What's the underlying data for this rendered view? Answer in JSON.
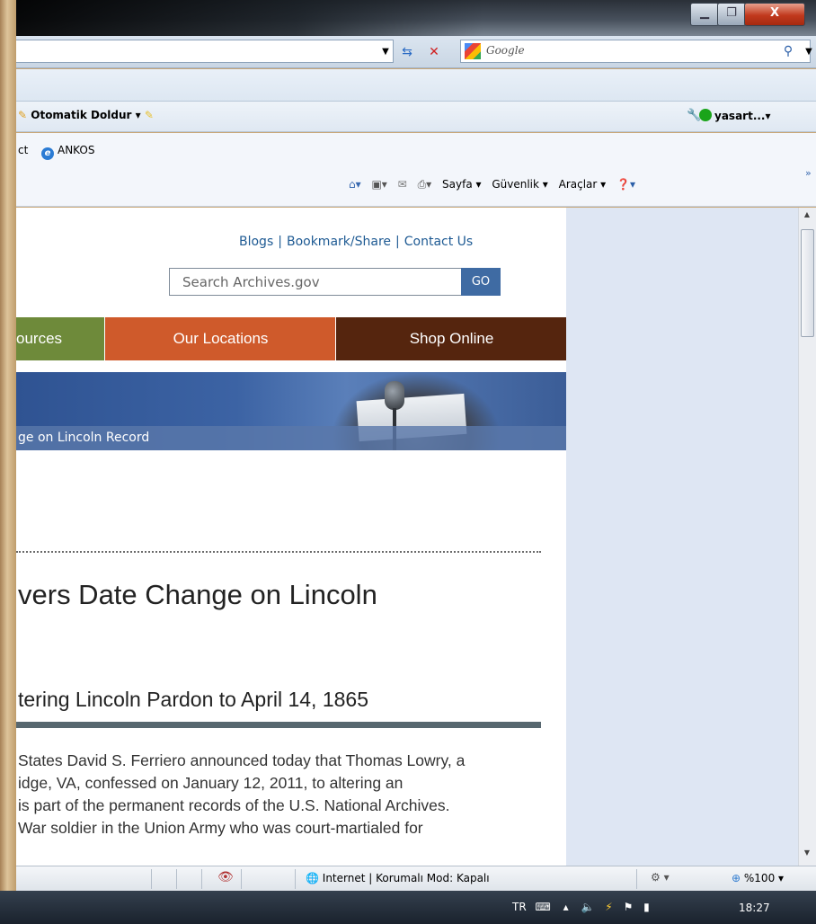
{
  "window": {
    "minimize_label": "▁",
    "maximize_label": "❐",
    "close_label": "X"
  },
  "search": {
    "placeholder": "Google"
  },
  "google_toolbar": {
    "autofill_label": "Otomatik Doldur ▾",
    "user_label": "yasart...▾"
  },
  "favorites": {
    "items": [
      {
        "label": "ct"
      },
      {
        "label": "ANKOS"
      }
    ]
  },
  "command_bar": {
    "page_label": "Sayfa ▾",
    "security_label": "Güvenlik ▾",
    "tools_label": "Araçlar ▾"
  },
  "site": {
    "top_links": [
      "Blogs",
      "Bookmark/Share",
      "Contact Us"
    ],
    "search_placeholder": "Search Archives.gov",
    "go_label": "GO",
    "nav": [
      "ources",
      "Our Locations",
      "Shop Online"
    ],
    "banner_caption": "ge on Lincoln Record",
    "headline": "vers Date Change on Lincoln",
    "subheadline": "tering Lincoln Pardon to April 14, 1865",
    "body_lines": [
      "States David S. Ferriero announced today that Thomas Lowry, a",
      "idge, VA, confessed on January 12, 2011, to altering an",
      "is part of the permanent records of the U.S. National Archives.",
      "War soldier in the Union Army who was court-martialed for"
    ]
  },
  "status_bar": {
    "zone_label": "Internet | Korumalı Mod: Kapalı",
    "zoom_label": "%100"
  },
  "taskbar": {
    "language": "TR",
    "clock": "18:27"
  },
  "colors": {
    "nav_green": "#6e8a3a",
    "nav_orange": "#cf5a2b",
    "nav_brown": "#55250e",
    "link_blue": "#1e5a93",
    "go_blue": "#3f6ba3"
  }
}
